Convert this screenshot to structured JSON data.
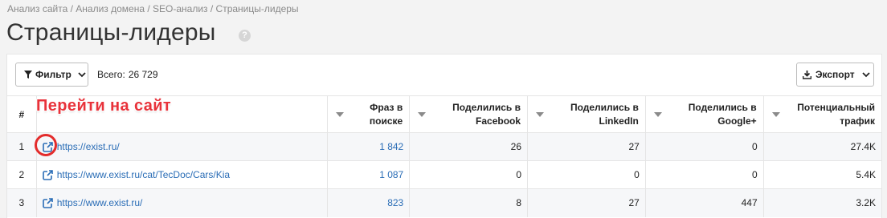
{
  "breadcrumb": "Анализ сайта / Анализ домена / SEO-анализ / Страницы-лидеры",
  "page": {
    "title": "Страницы-лидеры",
    "help_glyph": "?"
  },
  "toolbar": {
    "filter_label": "Фильтр",
    "total_label": "Всего:",
    "total_value": "26 729",
    "export_label": "Экспорт"
  },
  "table": {
    "headers": {
      "num": "#",
      "phrases": "Фраз в поиске",
      "facebook": "Поделились в Facebook",
      "linkedin": "Поделились в LinkedIn",
      "google": "Поделились в Google+",
      "traffic": "Потенциальный трафик"
    },
    "rows": [
      {
        "num": "1",
        "url": "https://exist.ru/",
        "phrases": "1 842",
        "facebook": "26",
        "linkedin": "27",
        "google": "0",
        "traffic": "27.4K"
      },
      {
        "num": "2",
        "url": "https://www.exist.ru/cat/TecDoc/Cars/Kia",
        "phrases": "1 087",
        "facebook": "0",
        "linkedin": "0",
        "google": "0",
        "traffic": "5.4K"
      },
      {
        "num": "3",
        "url": "https://www.exist.ru/",
        "phrases": "823",
        "facebook": "8",
        "linkedin": "27",
        "google": "447",
        "traffic": "3.2K"
      }
    ]
  },
  "annotation": {
    "label": "Перейти на сайт"
  },
  "colors": {
    "link": "#2a6db6",
    "annotation": "#e8323a"
  },
  "icons": [
    "help-icon",
    "filter-icon",
    "chevron-down-icon",
    "download-icon",
    "external-link-icon",
    "sort-caret-icon"
  ]
}
